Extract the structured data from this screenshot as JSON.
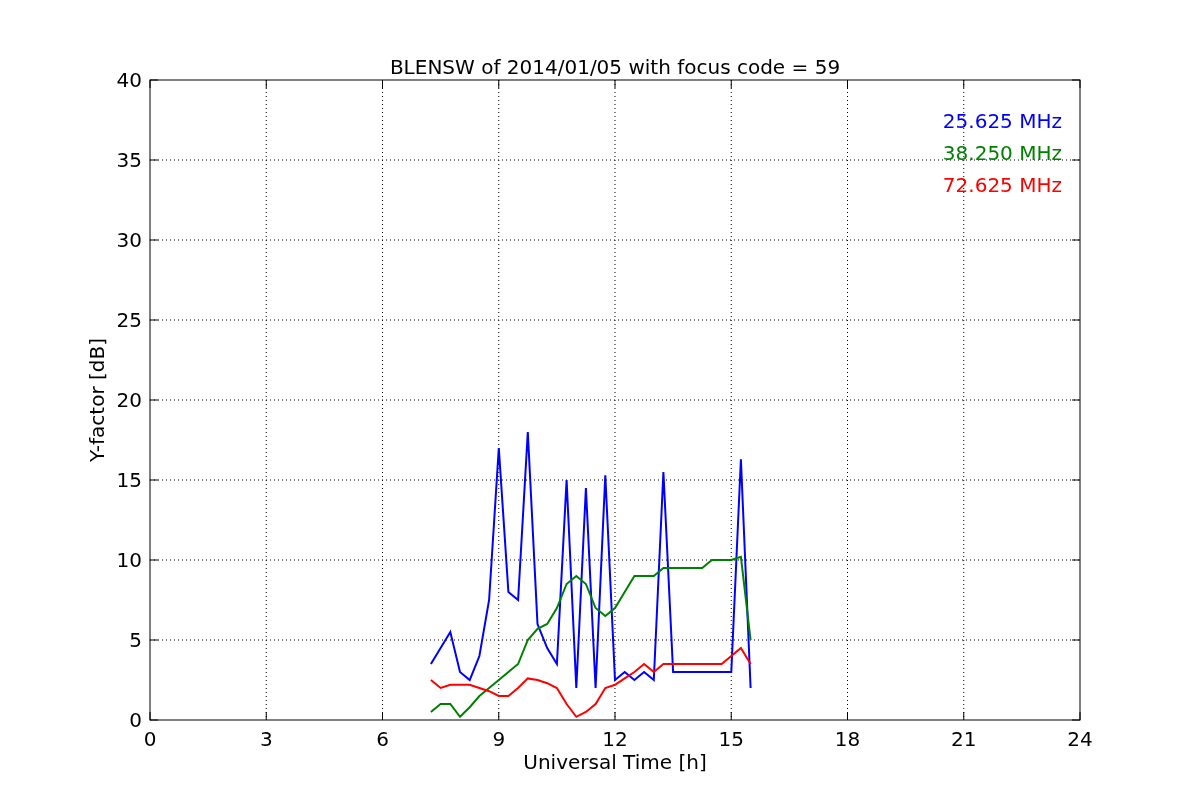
{
  "chart_data": {
    "type": "line",
    "title": "BLENSW of 2014/01/05 with focus code = 59",
    "xlabel": "Universal Time [h]",
    "ylabel": "Y-factor [dB]",
    "x": [
      7.25,
      7.5,
      7.75,
      8.0,
      8.25,
      8.5,
      8.75,
      9.0,
      9.25,
      9.5,
      9.75,
      10.0,
      10.25,
      10.5,
      10.75,
      11.0,
      11.25,
      11.5,
      11.75,
      12.0,
      12.25,
      12.5,
      12.75,
      13.0,
      13.25,
      13.5,
      13.75,
      14.0,
      14.25,
      14.5,
      14.75,
      15.0,
      15.25,
      15.5
    ],
    "series": [
      {
        "name": "25.625 MHz",
        "color": "#0000ff",
        "values": [
          3.5,
          4.5,
          5.5,
          3,
          2.5,
          4,
          7.5,
          17,
          8,
          7.5,
          18,
          6,
          4.5,
          3.5,
          15,
          2,
          14.5,
          2,
          15.3,
          2.5,
          3,
          2.5,
          3,
          2.5,
          15.5,
          3,
          3,
          3,
          3,
          3,
          3,
          3,
          16.3,
          2
        ]
      },
      {
        "name": "38.250 MHz",
        "color": "#008000",
        "values": [
          0.5,
          1,
          1,
          0.2,
          0.8,
          1.5,
          2,
          2.5,
          3,
          3.5,
          5,
          5.7,
          6,
          7,
          8.5,
          9,
          8.5,
          7,
          6.5,
          7,
          8,
          9,
          9,
          9,
          9.5,
          9.5,
          9.5,
          9.5,
          9.5,
          10,
          10,
          10,
          10.2,
          5
        ]
      },
      {
        "name": "72.625 MHz",
        "color": "#ff0000",
        "values": [
          2.5,
          2,
          2.2,
          2.2,
          2.2,
          2,
          1.8,
          1.5,
          1.5,
          2,
          2.6,
          2.5,
          2.3,
          2,
          1,
          0.2,
          0.5,
          1,
          2,
          2.2,
          2.6,
          3,
          3.5,
          3,
          3.5,
          3.5,
          3.5,
          3.5,
          3.5,
          3.5,
          3.5,
          4,
          4.5,
          3.5
        ]
      }
    ],
    "xlim": [
      0,
      24
    ],
    "ylim": [
      0,
      40
    ],
    "xticks": [
      0,
      3,
      6,
      9,
      12,
      15,
      18,
      21,
      24
    ],
    "yticks": [
      0,
      5,
      10,
      15,
      20,
      25,
      30,
      35,
      40
    ],
    "grid": true
  }
}
